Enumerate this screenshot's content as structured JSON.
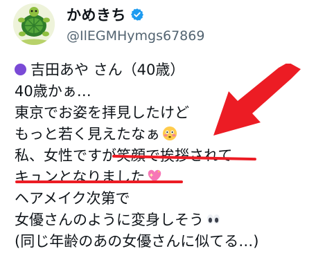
{
  "author": {
    "display_name": "かめきち",
    "handle": "@IlEGMHymgs67869",
    "verified": true
  },
  "tweet": {
    "lines": [
      "吉田あや さん（40歳）",
      "40歳かぁ…",
      "東京でお姿を拝見したけど",
      "もっと若く見えたなぁ",
      "私、女性ですが笑顔で挨拶されて",
      "キュンとなりました",
      "ヘアメイク次第で",
      "女優さんのように変身しそう",
      "(同じ年齢のあの女優さんに似てる…)"
    ],
    "emojis": {
      "line_1_prefix": "purple-circle-icon",
      "line_4_suffix": "flushed-face-icon",
      "line_6_suffix": "sparkling-heart-icon",
      "line_8_suffix": "eyes-icon"
    }
  },
  "annotations": {
    "arrow_color": "#ec1c24",
    "underline_color": "#ec1c24"
  },
  "colors": {
    "text": "#0f1419",
    "handle": "#536471",
    "verified": "#1d9bf0",
    "purple_dot": "#7a4ad6"
  }
}
